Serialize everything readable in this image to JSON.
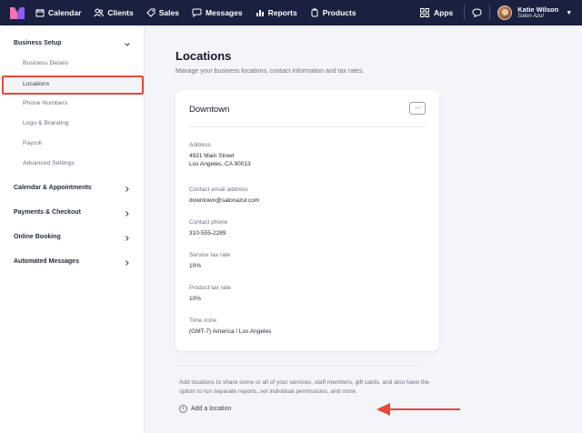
{
  "nav": {
    "items": [
      {
        "label": "Calendar",
        "icon": "calendar-icon"
      },
      {
        "label": "Clients",
        "icon": "people-icon"
      },
      {
        "label": "Sales",
        "icon": "tag-icon"
      },
      {
        "label": "Messages",
        "icon": "chat-bubble-icon"
      },
      {
        "label": "Reports",
        "icon": "bar-chart-icon"
      },
      {
        "label": "Products",
        "icon": "box-icon"
      }
    ],
    "apps_label": "Apps",
    "user": {
      "name": "Katie Wilson",
      "business": "Salon Azul"
    },
    "colors": {
      "bar": "#1a2140",
      "accent": "#e8473a"
    }
  },
  "sidebar": {
    "business_setup": "Business Setup",
    "sub_items": [
      "Business Details",
      "Locations",
      "Phone Numbers",
      "Logo & Branding",
      "Payroll",
      "Advanced Settings"
    ],
    "active_item": "Locations",
    "sections": [
      "Calendar & Appointments",
      "Payments & Checkout",
      "Online Booking",
      "Automated Messages"
    ]
  },
  "main": {
    "title": "Locations",
    "description": "Manage your business locations, contact information and tax rates.",
    "card": {
      "name": "Downtown",
      "more_label": "···",
      "fields": [
        {
          "label": "Address",
          "value": [
            "4921 Main Street",
            "Los Angeles, CA 90013"
          ]
        },
        {
          "label": "Contact email address",
          "value": [
            "downtown@salonazul.com"
          ]
        },
        {
          "label": "Contact phone",
          "value": [
            "310-555-2289"
          ]
        },
        {
          "label": "Service tax rate",
          "value": [
            "10%"
          ]
        },
        {
          "label": "Product tax rate",
          "value": [
            "10%"
          ]
        },
        {
          "label": "Time zone",
          "value": [
            "(GMT-7) America / Los Angeles"
          ]
        }
      ]
    },
    "info_text": "Add locations to share some or all of your services, staff members, gift cards, and also have the option to run separate reports, set individual permissions, and more.",
    "add_location_label": "Add a location"
  }
}
